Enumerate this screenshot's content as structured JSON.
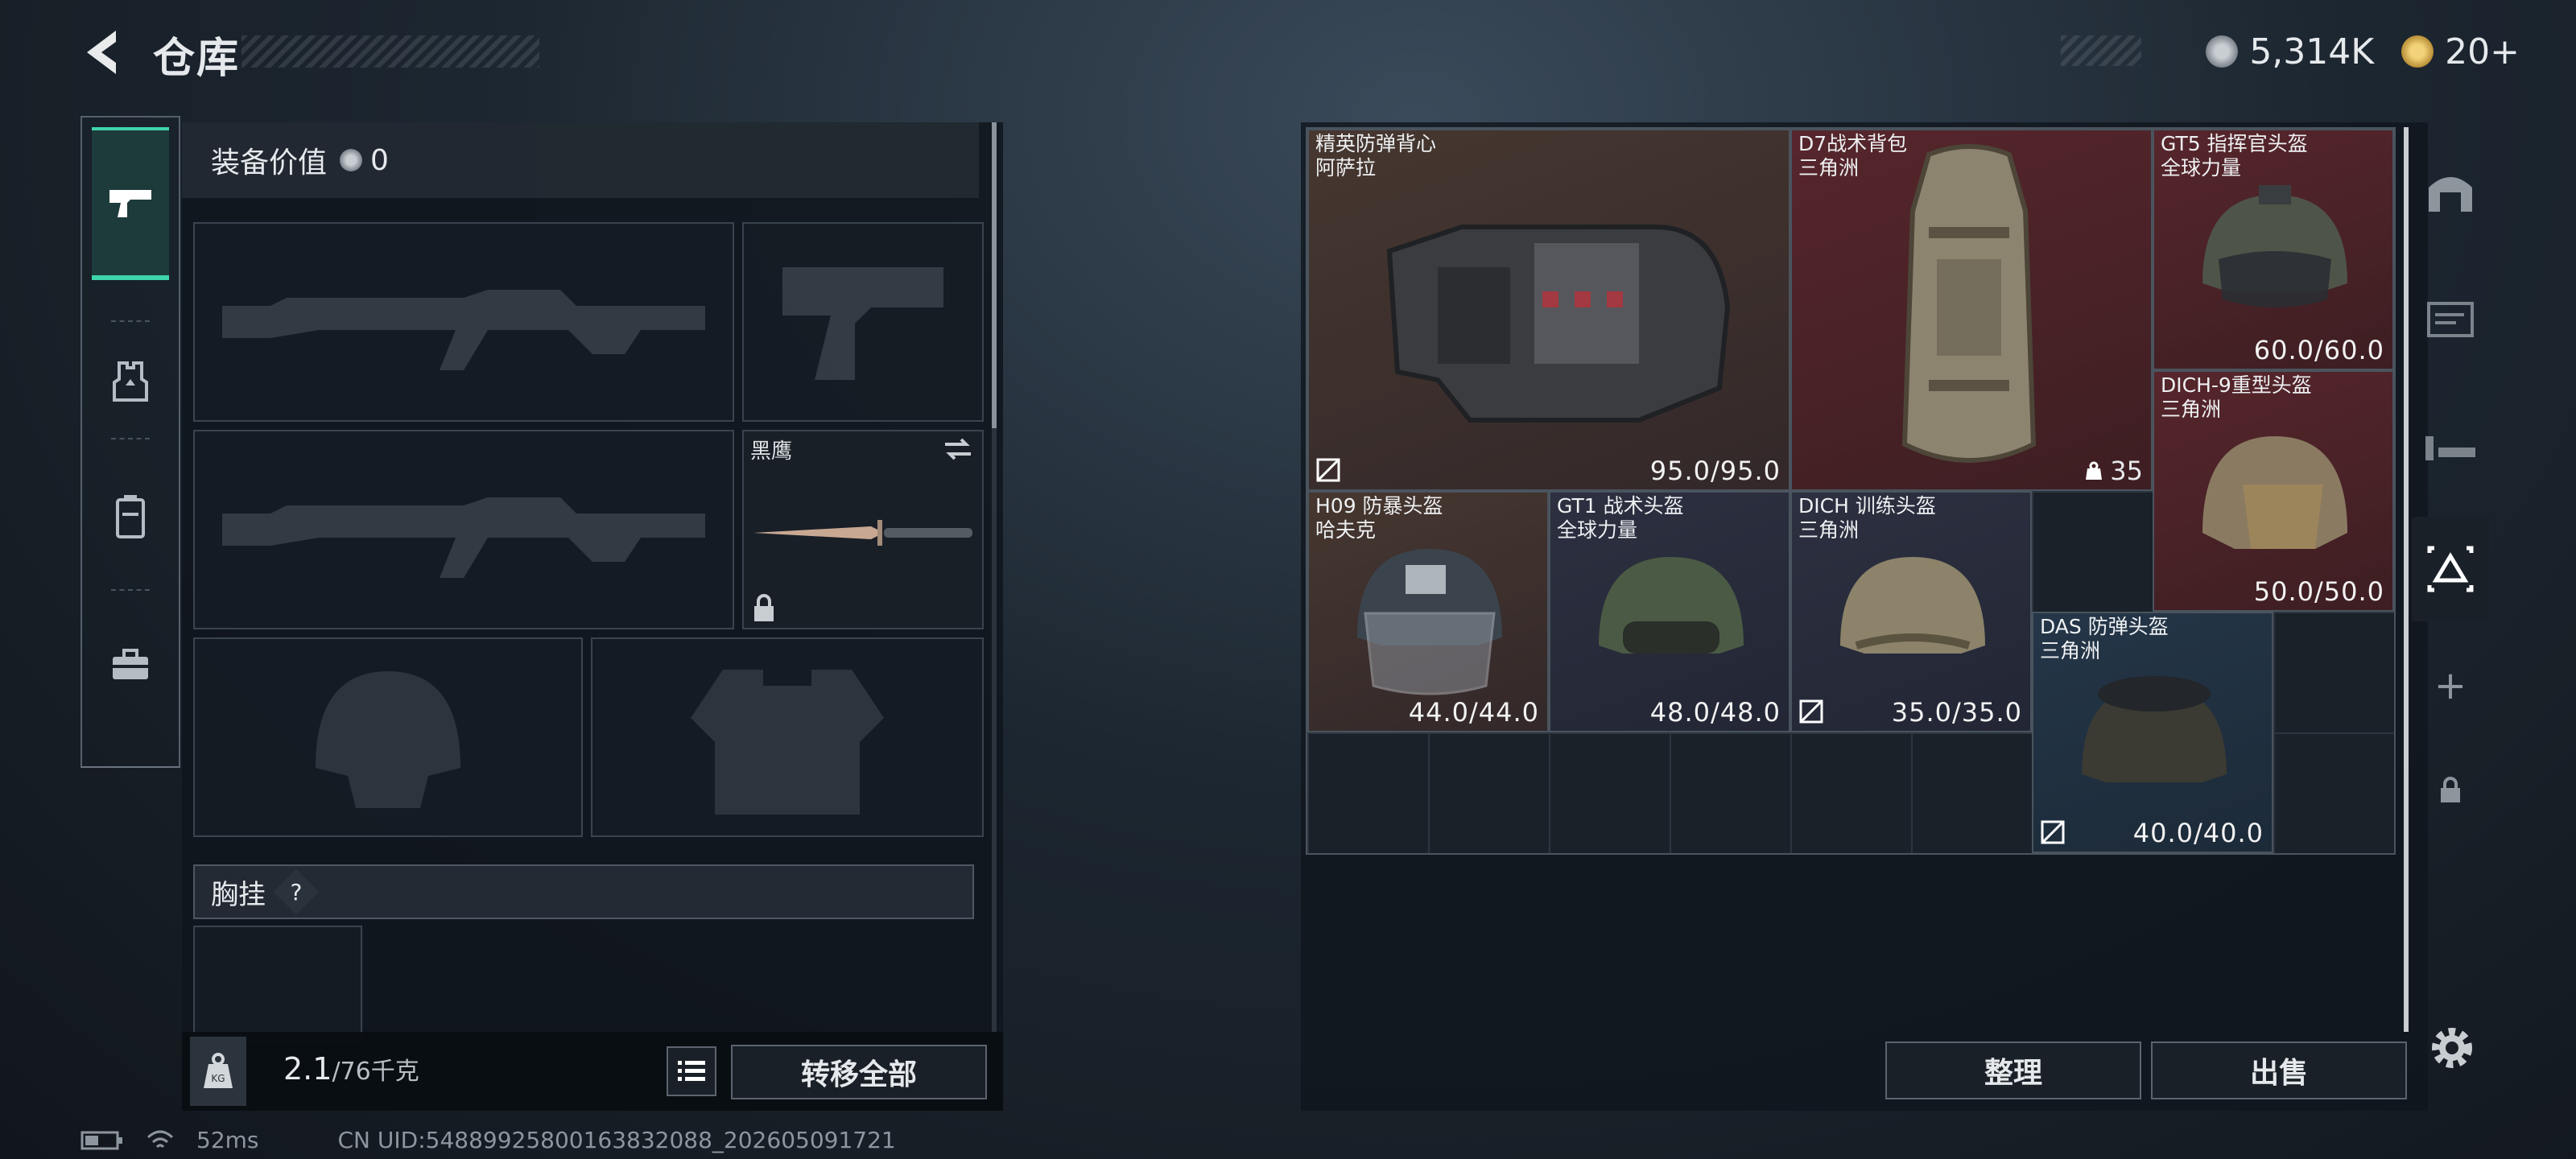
{
  "header": {
    "title": "仓库",
    "coins": "5,314K",
    "tickets": "20+"
  },
  "equipment": {
    "value_label": "装备价值",
    "value": "0"
  },
  "slots": {
    "melee_name": "黑鹰",
    "chest_label": "胸挂",
    "chest_help": "?"
  },
  "bottom": {
    "weight": "2.1",
    "weight_max": "/76千克",
    "transfer_all": "转移全部"
  },
  "items": [
    {
      "name": "精英防弹背心",
      "sub": "阿萨拉",
      "dur": "95.0/95.0"
    },
    {
      "name": "D7战术背包",
      "sub": "三角洲",
      "dur": "",
      "count": "35"
    },
    {
      "name": "GT5 指挥官头盔",
      "sub": "全球力量",
      "dur": "60.0/60.0"
    },
    {
      "name": "DICH-9重型头盔",
      "sub": "三角洲",
      "dur": "50.0/50.0"
    },
    {
      "name": "H09 防暴头盔",
      "sub": "哈夫克",
      "dur": "44.0/44.0"
    },
    {
      "name": "GT1 战术头盔",
      "sub": "全球力量",
      "dur": "48.0/48.0"
    },
    {
      "name": "DICH 训练头盔",
      "sub": "三角洲",
      "dur": "35.0/35.0"
    },
    {
      "name": "DAS 防弹头盔",
      "sub": "三角洲",
      "dur": "40.0/40.0"
    }
  ],
  "actions": {
    "sort": "整理",
    "sell": "出售"
  },
  "footer": {
    "ping": "52ms",
    "uid": "CN UID:5488992580016383​2088_202605091721"
  },
  "icons": [
    "back-icon",
    "silver-coin-icon",
    "ticket-icon",
    "pistol-icon",
    "vest-icon",
    "rig-icon",
    "briefcase-icon",
    "weight-icon",
    "list-icon",
    "swap-icon",
    "lock-icon",
    "home-icon",
    "weapon-bench-icon",
    "tactical-icon",
    "storage-icon",
    "plus-icon",
    "settings-icon",
    "battery-icon",
    "wifi-icon"
  ],
  "colors": {
    "accent": "#3fd4a9",
    "vest_bg": "#3b2e28",
    "backpack_bg": "#4a2328",
    "helmet_blue_bg": "#2a2d40",
    "helmet_red_bg": "#4a2328",
    "helmet_cyan_bg": "#223346"
  }
}
